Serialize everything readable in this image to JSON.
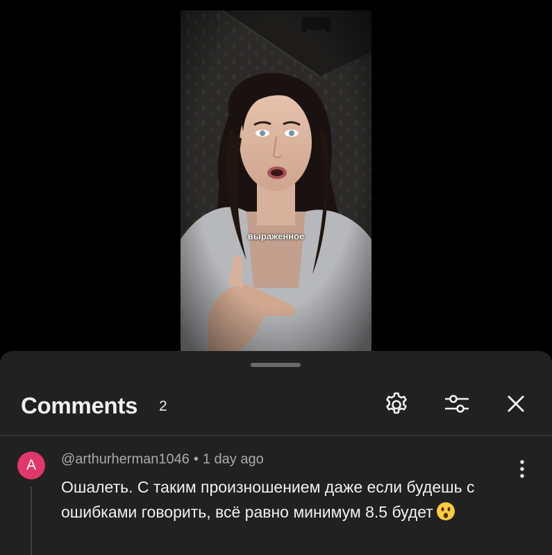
{
  "video": {
    "caption": "выраженное"
  },
  "comments_panel": {
    "title": "Comments",
    "count": "2",
    "icons": {
      "settings": "gear-icon",
      "filter": "sliders-icon",
      "close": "close-icon"
    }
  },
  "comments": [
    {
      "avatar_letter": "A",
      "avatar_color": "#e0386a",
      "author": "@arthurherman1046",
      "separator": "•",
      "time": "1 day ago",
      "text": "Ошалеть. С таким произношением даже если будешь с ошибками говорить, всё равно минимум 8.5 будет",
      "emoji": "astonished-face-emoji"
    }
  ],
  "colors": {
    "sheet_background": "#212121",
    "page_background": "#000000",
    "meta_text": "#aaaaaa",
    "primary_text": "#f1f1f1"
  }
}
